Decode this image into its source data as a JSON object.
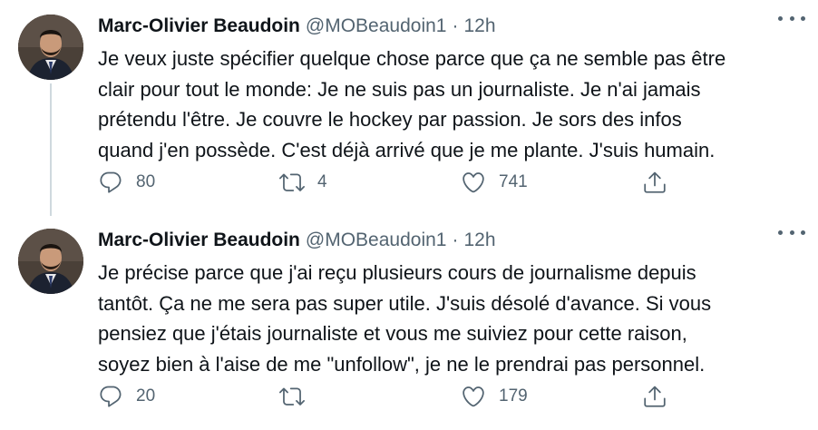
{
  "tweets": [
    {
      "author_name": "Marc-Olivier Beaudoin",
      "handle": "@MOBeaudoin1",
      "separator": "·",
      "time": "12h",
      "text": "Je veux juste spécifier quelque chose parce que ça ne semble pas être\nclair pour tout le monde: Je ne suis pas un journaliste. Je n'ai jamais\nprétendu l'être. Je couvre le hockey par passion. Je sors des infos\nquand j'en possède. C'est déjà arrivé que je me plante. J'suis humain.",
      "replies": "80",
      "retweets": "4",
      "likes": "741"
    },
    {
      "author_name": "Marc-Olivier Beaudoin",
      "handle": "@MOBeaudoin1",
      "separator": "·",
      "time": "12h",
      "text": "Je précise parce que j'ai reçu plusieurs cours de journalisme depuis\ntantôt. Ça ne me sera pas super utile. J'suis désolé d'avance. Si vous\npensiez que j'étais journaliste et vous me suiviez pour cette raison,\nsoyez bien à l'aise de me \"unfollow\", je ne le prendrai pas personnel.",
      "replies": "20",
      "retweets": "",
      "likes": "179"
    }
  ],
  "icons": {
    "reply": "reply-icon",
    "retweet": "retweet-icon",
    "like": "heart-icon",
    "share": "share-icon",
    "more": "more-icon"
  },
  "colors": {
    "text": "#0f1419",
    "secondary": "#536471",
    "thread_line": "#cfd9de"
  }
}
